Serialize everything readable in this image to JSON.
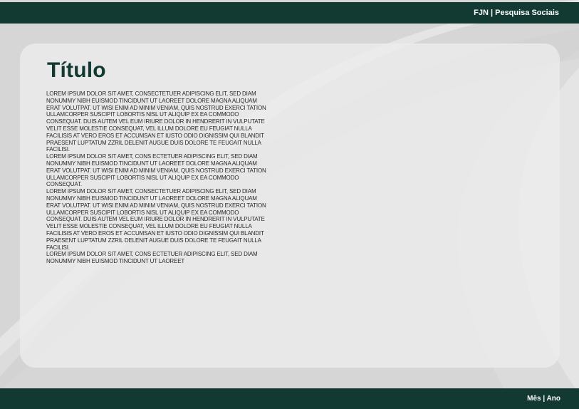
{
  "header": {
    "right_text": "FJN | Pesquisa Sociais"
  },
  "main": {
    "title": "Título",
    "paragraphs": [
      "LOREM IPSUM DOLOR SIT AMET, CONSECTETUER ADIPISCING ELIT, SED DIAM NONUMMY NIBH EUISMOD TINCIDUNT UT LAOREET DOLORE MAGNA ALIQUAM ERAT VOLUTPAT. UT WISI ENIM AD MINIM VENIAM, QUIS NOSTRUD EXERCI TATION ULLAMCORPER SUSCIPIT LOBORTIS NISL UT ALIQUIP EX EA COMMODO CONSEQUAT. DUIS AUTEM VEL EUM IRIURE DOLOR IN HENDRERIT IN VULPUTATE VELIT ESSE MOLESTIE CONSEQUAT, VEL ILLUM DOLORE EU FEUGIAT NULLA FACILISIS AT VERO EROS ET ACCUMSAN ET IUSTO ODIO DIGNISSIM QUI BLANDIT PRAESENT LUPTATUM ZZRIL DELENIT AUGUE DUIS DOLORE TE FEUGAIT NULLA FACILISI.",
      "LOREM IPSUM DOLOR SIT AMET, CONS ECTETUER ADIPISCING ELIT, SED DIAM NONUMMY NIBH EUISMOD TINCIDUNT UT LAOREET DOLORE MAGNA ALIQUAM ERAT VOLUTPAT. UT WISI ENIM AD MINIM VENIAM, QUIS NOSTRUD EXERCI TATION ULLAMCORPER SUSCIPIT LOBORTIS NISL UT ALIQUIP EX EA COMMODO CONSEQUAT.",
      "LOREM IPSUM DOLOR SIT AMET, CONSECTETUER ADIPISCING ELIT, SED DIAM NONUMMY NIBH EUISMOD TINCIDUNT UT LAOREET DOLORE MAGNA ALIQUAM ERAT VOLUTPAT. UT WISI ENIM AD MINIM VENIAM, QUIS NOSTRUD EXERCI TATION ULLAMCORPER SUSCIPIT LOBORTIS NISL UT ALIQUIP EX EA COMMODO CONSEQUAT. DUIS AUTEM VEL EUM IRIURE DOLOR IN HENDRERIT IN VULPUTATE VELIT ESSE MOLESTIE CONSEQUAT, VEL ILLUM DOLORE EU FEUGIAT NULLA FACILISIS AT VERO EROS ET ACCUMSAN ET IUSTO ODIO DIGNISSIM QUI BLANDIT PRAESENT LUPTATUM ZZRIL DELENIT AUGUE DUIS DOLORE TE FEUGAIT NULLA FACILISI.",
      "LOREM IPSUM DOLOR SIT AMET, CONS ECTETUER ADIPISCING ELIT, SED DIAM NONUMMY NIBH EUISMOD TINCIDUNT UT LAOREET"
    ]
  },
  "footer": {
    "right_text": "Mês | Ano"
  },
  "colors": {
    "bar": "#123a33",
    "background": "#d6d6d6",
    "title": "#123a33"
  }
}
